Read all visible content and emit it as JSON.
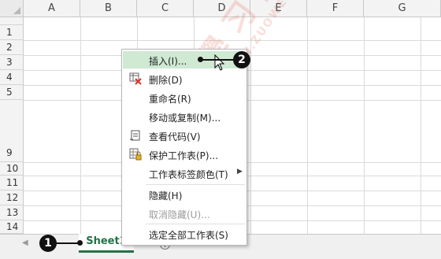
{
  "columns": [
    "A",
    "B",
    "C",
    "D",
    "E",
    "F",
    "G"
  ],
  "rows": [
    "1",
    "2",
    "3",
    "4",
    "5",
    "9",
    "10",
    "11",
    "12",
    "13",
    "14"
  ],
  "context_menu": {
    "items": [
      {
        "label": "插入(I)...",
        "icon": "insert-sheet-icon",
        "state": "highlighted"
      },
      {
        "label": "删除(D)",
        "icon": "delete-sheet-icon",
        "state": "normal"
      },
      {
        "label": "重命名(R)",
        "icon": "",
        "state": "normal"
      },
      {
        "label": "移动或复制(M)...",
        "icon": "",
        "state": "normal"
      },
      {
        "label": "查看代码(V)",
        "icon": "view-code-icon",
        "state": "normal"
      },
      {
        "label": "保护工作表(P)...",
        "icon": "protect-sheet-icon",
        "state": "normal"
      },
      {
        "label": "工作表标签颜色(T)",
        "icon": "",
        "state": "normal",
        "submenu": true
      },
      {
        "label": "隐藏(H)",
        "icon": "",
        "state": "normal"
      },
      {
        "label": "取消隐藏(U)...",
        "icon": "",
        "state": "disabled"
      },
      {
        "label": "选定全部工作表(S)",
        "icon": "",
        "state": "normal"
      }
    ]
  },
  "sheet_tab": {
    "label": "Sheet1",
    "color": "#217346"
  },
  "add_sheet_symbol": "+",
  "callouts": [
    "1",
    "2"
  ],
  "watermark": {
    "main": "學 习 网",
    "sub": "WWW.ZUOWEN.COM"
  },
  "colors": {
    "highlight": "#cfe9d3",
    "accent": "#217346",
    "delete_red": "#d9342b"
  }
}
